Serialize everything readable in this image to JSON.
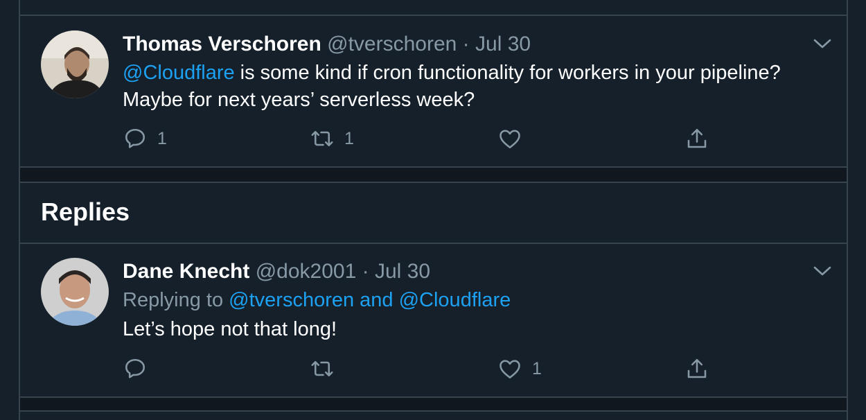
{
  "tweet": {
    "author_name": "Thomas Verschoren",
    "handle": "@tverschoren",
    "separator": "·",
    "date": "Jul 30",
    "mention": "@Cloudflare",
    "text_line1_rest": " is some kind if cron functionality for workers in your pipeline?",
    "text_line2": "Maybe for next years’ serverless week?",
    "reply_count": "1",
    "retweet_count": "1",
    "like_count": "",
    "avatar_icon": "person-photo-avatar"
  },
  "replies_heading": "Replies",
  "reply": {
    "author_name": "Dane Knecht",
    "handle": "@dok2001",
    "separator": "·",
    "date": "Jul 30",
    "replying_prefix": "Replying to ",
    "replying_to": "@tverschoren and @Cloudflare",
    "text": "Let’s hope not that long!",
    "reply_count": "",
    "retweet_count": "",
    "like_count": "1",
    "avatar_icon": "person-photo-avatar"
  },
  "colors": {
    "background": "#15202b",
    "divider": "#38444d",
    "muted": "#8899a6",
    "link": "#1da1f2"
  }
}
